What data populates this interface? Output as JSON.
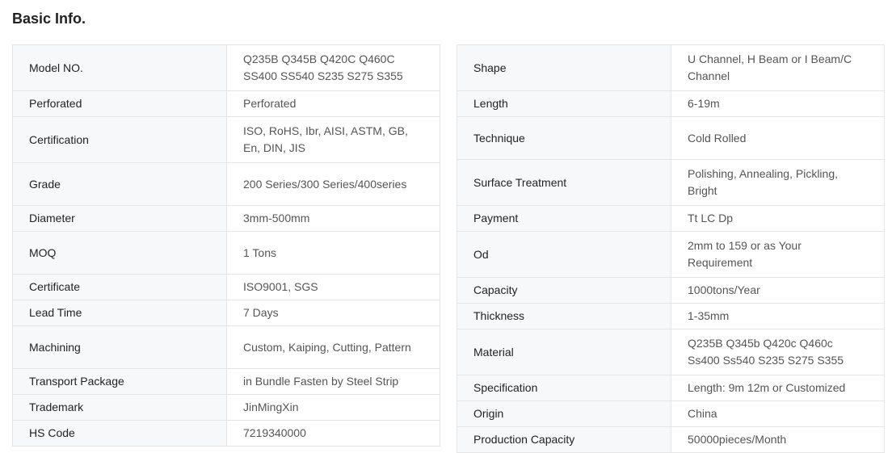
{
  "title": "Basic Info.",
  "left_table": [
    {
      "key": "Model NO.",
      "value": "Q235B Q345B Q420C Q460C SS400 SS540 S235 S275 S355",
      "lines": 2
    },
    {
      "key": "Perforated",
      "value": "Perforated",
      "lines": 1
    },
    {
      "key": "Certification",
      "value": "ISO, RoHS, Ibr, AISI, ASTM, GB, En, DIN, JIS",
      "lines": 2
    },
    {
      "key": "Grade",
      "value": "200 Series/300 Series/400series",
      "lines": 2
    },
    {
      "key": "Diameter",
      "value": "3mm-500mm",
      "lines": 1
    },
    {
      "key": "MOQ",
      "value": "1 Tons",
      "lines": 2
    },
    {
      "key": "Certificate",
      "value": "ISO9001, SGS",
      "lines": 1
    },
    {
      "key": "Lead Time",
      "value": "7 Days",
      "lines": 1
    },
    {
      "key": "Machining",
      "value": "Custom, Kaiping, Cutting, Pattern",
      "lines": 2
    },
    {
      "key": "Transport Package",
      "value": "in Bundle Fasten by Steel Strip",
      "lines": 1
    },
    {
      "key": "Trademark",
      "value": "JinMingXin",
      "lines": 1
    },
    {
      "key": "HS Code",
      "value": "7219340000",
      "lines": 1
    }
  ],
  "right_table": [
    {
      "key": "Shape",
      "value": "U Channel, H Beam or I Beam/C Channel",
      "lines": 2
    },
    {
      "key": "Length",
      "value": "6-19m",
      "lines": 1
    },
    {
      "key": "Technique",
      "value": "Cold Rolled",
      "lines": 2
    },
    {
      "key": "Surface Treatment",
      "value": "Polishing, Annealing, Pickling, Bright",
      "lines": 2
    },
    {
      "key": "Payment",
      "value": "Tt LC Dp",
      "lines": 1
    },
    {
      "key": "Od",
      "value": "2mm to 159 or as Your Requirement",
      "lines": 2
    },
    {
      "key": "Capacity",
      "value": "1000tons/Year",
      "lines": 1
    },
    {
      "key": "Thickness",
      "value": "1-35mm",
      "lines": 1
    },
    {
      "key": "Material",
      "value": "Q235B Q345b Q420c Q460c Ss400 Ss540 S235 S275 S355",
      "lines": 2
    },
    {
      "key": "Specification",
      "value": "Length: 9m 12m or Customized",
      "lines": 1
    },
    {
      "key": "Origin",
      "value": "China",
      "lines": 1
    },
    {
      "key": "Production Capacity",
      "value": "50000pieces/Month",
      "lines": 1
    }
  ]
}
